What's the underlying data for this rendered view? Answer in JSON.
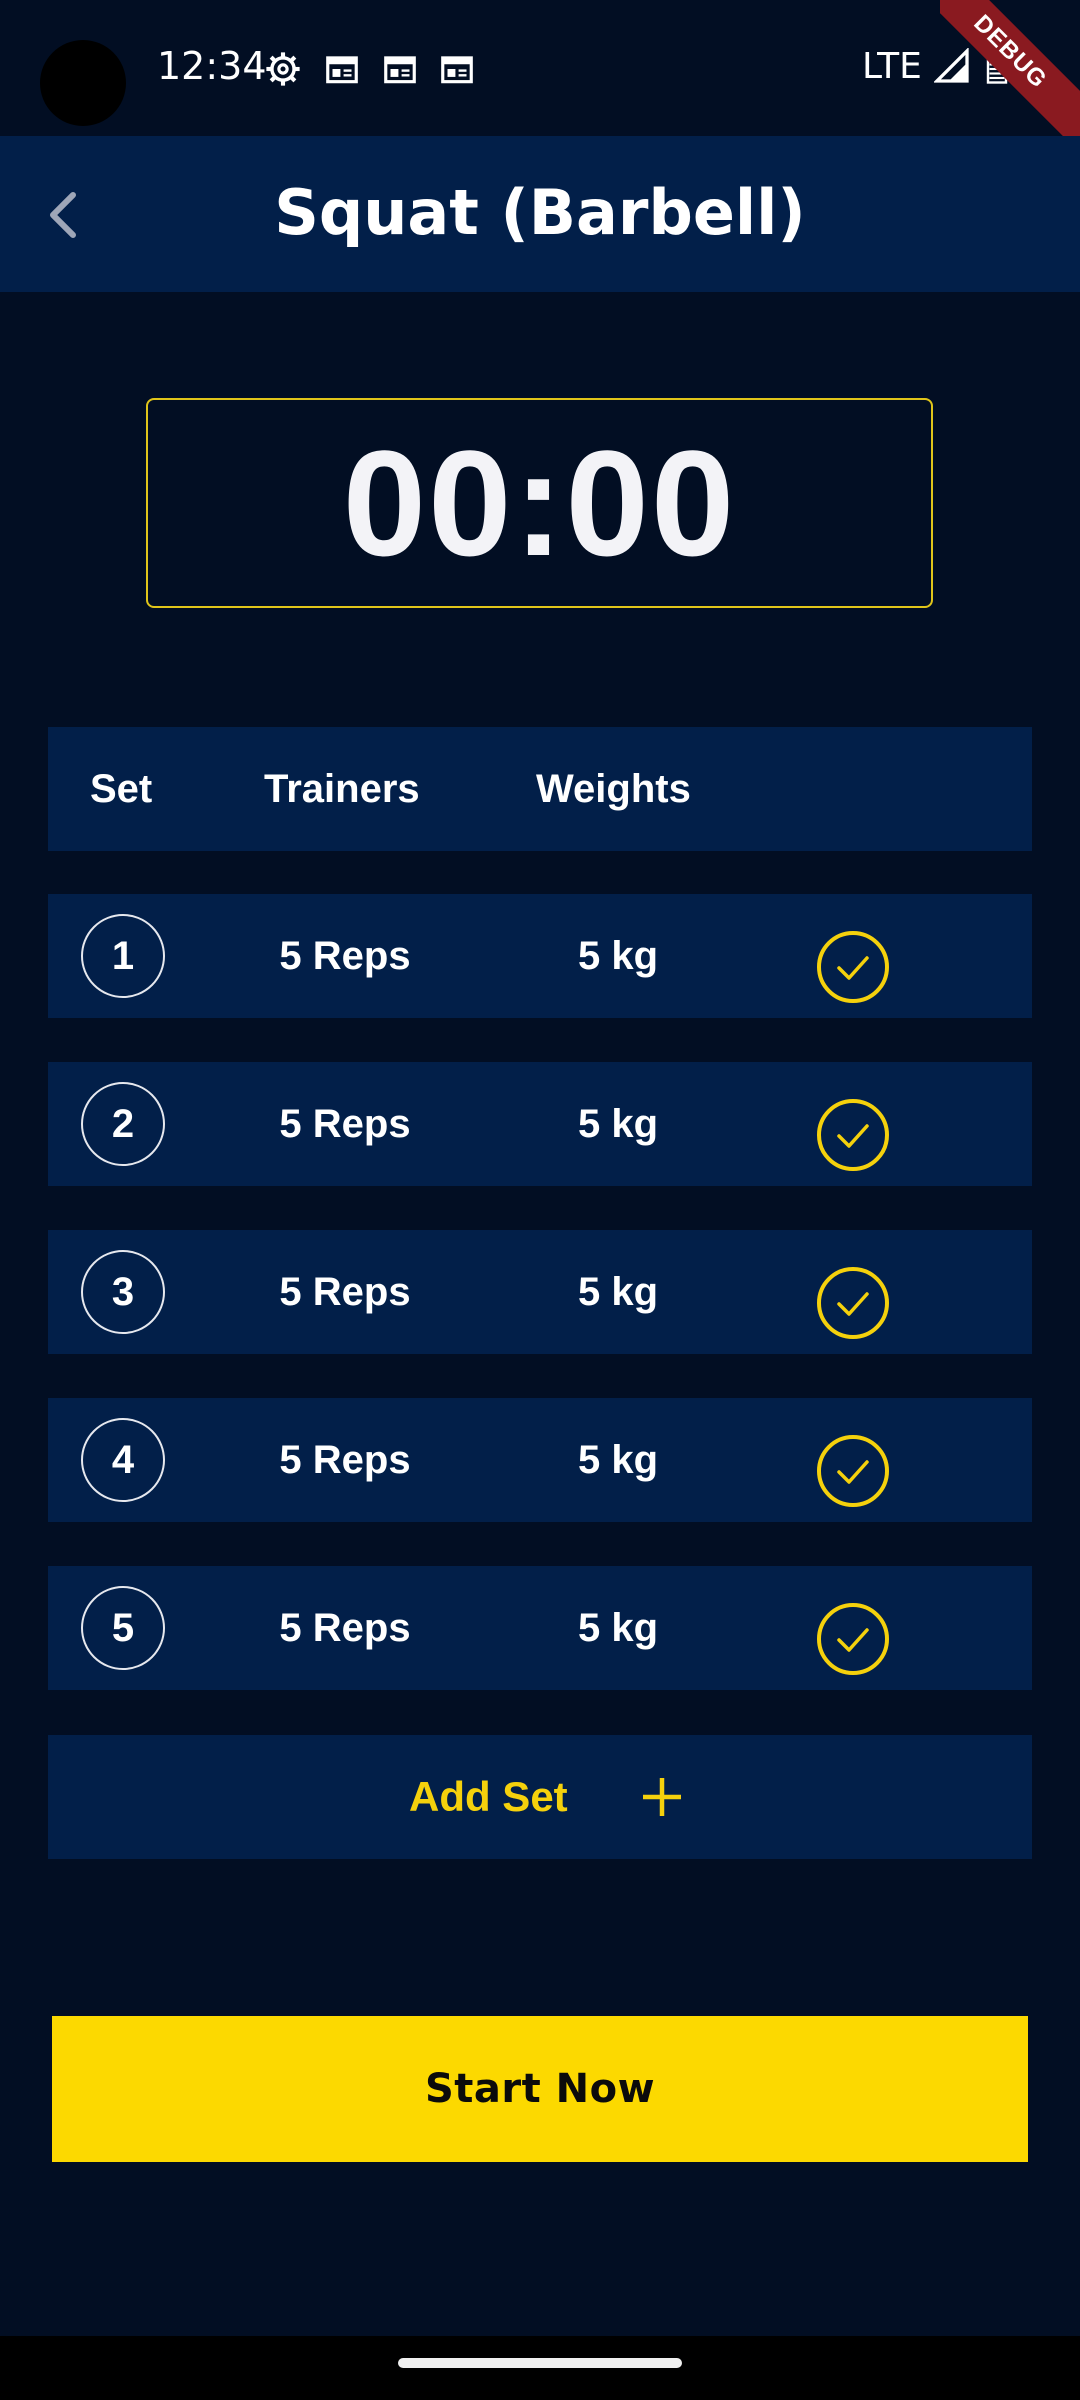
{
  "status_bar": {
    "time": "12:34",
    "network": "LTE",
    "icons": [
      "settings-gear-icon",
      "calendar-icon",
      "calendar-icon",
      "calendar-icon",
      "signal-icon",
      "battery-icon"
    ],
    "debug_banner": "DEBUG"
  },
  "app_bar": {
    "title": "Squat (Barbell)",
    "back_icon": "chevron-left-icon"
  },
  "timer": {
    "value": "00:00",
    "border_color": "#e0c51a"
  },
  "table": {
    "headers": {
      "set": "Set",
      "trainers": "Trainers",
      "weights": "Weights"
    },
    "rows": [
      {
        "set": "1",
        "reps": "5 Reps",
        "weight": "5 kg"
      },
      {
        "set": "2",
        "reps": "5 Reps",
        "weight": "5 kg"
      },
      {
        "set": "3",
        "reps": "5 Reps",
        "weight": "5 kg"
      },
      {
        "set": "4",
        "reps": "5 Reps",
        "weight": "5 kg"
      },
      {
        "set": "5",
        "reps": "5 Reps",
        "weight": "5 kg"
      }
    ],
    "check_icon": "check-circle-icon"
  },
  "add_set": {
    "label": "Add Set",
    "icon": "plus-icon"
  },
  "start_button": {
    "label": "Start Now"
  },
  "colors": {
    "background": "#020e23",
    "panel": "#021f49",
    "accent": "#fcd900",
    "accent_text": "#f5d10c"
  }
}
